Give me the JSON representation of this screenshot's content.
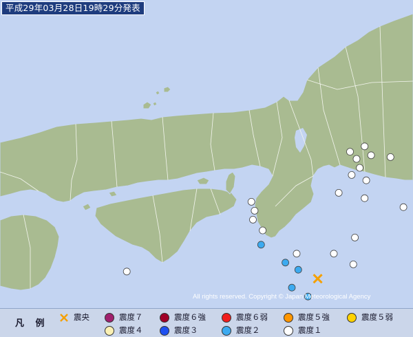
{
  "issue_text": "平成29年03月28日19時29分発表",
  "copyright": "All rights reserved. Copyright © Japan Meteorological Agency",
  "colors": {
    "sea": "#c3d4f2",
    "land": "#a9bb91",
    "border": "#f4f6ef",
    "epicenter": "#f5a000"
  },
  "legend": {
    "title": "凡 例",
    "items": [
      {
        "id": "epicenter",
        "label": "震央",
        "icon": "x-cross-icon",
        "color": "#f5a000"
      },
      {
        "id": "int7",
        "label": "震度７",
        "icon": "circle-icon",
        "color": "#a0206e"
      },
      {
        "id": "int6u",
        "label": "震度６強",
        "icon": "circle-icon",
        "color": "#a00028"
      },
      {
        "id": "int6l",
        "label": "震度６弱",
        "icon": "circle-icon",
        "color": "#f01e1e"
      },
      {
        "id": "int5u",
        "label": "震度５強",
        "icon": "circle-icon",
        "color": "#ff9600"
      },
      {
        "id": "int5l",
        "label": "震度５弱",
        "icon": "circle-icon",
        "color": "#ffd200"
      },
      {
        "id": "int4",
        "label": "震度４",
        "icon": "circle-icon",
        "color": "#faf0b4"
      },
      {
        "id": "int3",
        "label": "震度３",
        "icon": "circle-icon",
        "color": "#1e50f0"
      },
      {
        "id": "int2",
        "label": "震度２",
        "icon": "circle-icon",
        "color": "#3caaf0"
      },
      {
        "id": "int1",
        "label": "震度１",
        "icon": "circle-icon",
        "color": "#ffffff"
      }
    ]
  },
  "observations": {
    "epicenter": {
      "lat": 33.68,
      "lon": 135.53
    },
    "stations": [
      {
        "intensity": "1",
        "lat": 34.42,
        "lon": 135.82
      },
      {
        "intensity": "1",
        "lat": 34.39,
        "lon": 135.73
      },
      {
        "intensity": "1",
        "lat": 34.37,
        "lon": 135.86
      },
      {
        "intensity": "1",
        "lat": 34.35,
        "lon": 135.77
      },
      {
        "intensity": "1",
        "lat": 34.36,
        "lon": 135.98
      },
      {
        "intensity": "1",
        "lat": 34.3,
        "lon": 135.79
      },
      {
        "intensity": "1",
        "lat": 34.26,
        "lon": 135.74
      },
      {
        "intensity": "1",
        "lat": 34.23,
        "lon": 135.83
      },
      {
        "intensity": "1",
        "lat": 34.16,
        "lon": 135.66
      },
      {
        "intensity": "1",
        "lat": 34.13,
        "lon": 135.82
      },
      {
        "intensity": "1",
        "lat": 34.11,
        "lon": 135.12
      },
      {
        "intensity": "1",
        "lat": 34.06,
        "lon": 135.14
      },
      {
        "intensity": "1",
        "lat": 34.01,
        "lon": 135.13
      },
      {
        "intensity": "1",
        "lat": 33.95,
        "lon": 135.19
      },
      {
        "intensity": "1",
        "lat": 34.08,
        "lon": 136.06
      },
      {
        "intensity": "1",
        "lat": 33.91,
        "lon": 135.76
      },
      {
        "intensity": "1",
        "lat": 33.82,
        "lon": 135.4
      },
      {
        "intensity": "1",
        "lat": 33.82,
        "lon": 135.63
      },
      {
        "intensity": "1",
        "lat": 33.76,
        "lon": 135.75
      },
      {
        "intensity": "1",
        "lat": 33.72,
        "lon": 134.35
      },
      {
        "intensity": "2",
        "lat": 33.87,
        "lon": 135.18
      },
      {
        "intensity": "2",
        "lat": 33.77,
        "lon": 135.33
      },
      {
        "intensity": "2",
        "lat": 33.73,
        "lon": 135.41
      },
      {
        "intensity": "2",
        "lat": 33.63,
        "lon": 135.37
      },
      {
        "intensity": "2",
        "lat": 33.58,
        "lon": 135.47
      }
    ]
  }
}
